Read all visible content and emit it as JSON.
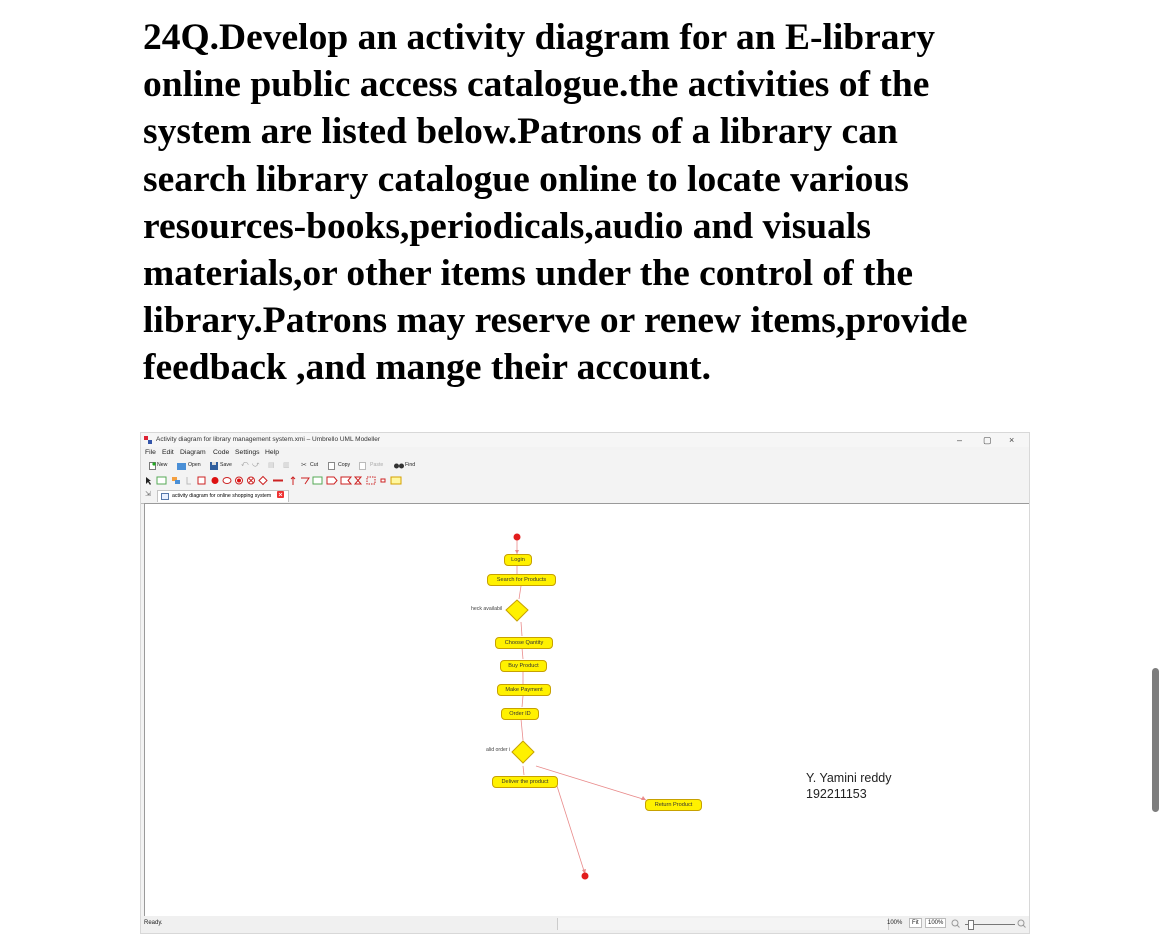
{
  "question": {
    "text": "24Q.Develop an activity diagram for an E-library\nonline public access catalogue.the activities of the\nsystem are listed below.Patrons of a library can\nsearch library catalogue online to locate various\nresources-books,periodicals,audio and visuals\nmaterials,or other items under the control of the\nlibrary.Patrons may reserve or renew items,provide\nfeedback ,and mange their account."
  },
  "window": {
    "title": "Activity diagram for library management system.xmi – Umbrello UML Modeller",
    "minimize": "–",
    "maximize": "▢",
    "close": "×"
  },
  "menu": [
    "File",
    "Edit",
    "Diagram",
    "Code",
    "Settings",
    "Help"
  ],
  "toolbar": {
    "new": "New",
    "open": "Open",
    "save": "Save",
    "cut": "Cut",
    "copy": "Copy",
    "paste": "Paste",
    "find": "Find"
  },
  "tab": {
    "label": "activity diagram for online shopping system"
  },
  "diagram": {
    "nodes": {
      "login": "Login",
      "search": "Search for Products",
      "choose": "Choose Qantity",
      "buy": "Buy Product",
      "payment": "Make Payment",
      "order_id": "Order ID",
      "deliver": "Deliver the product",
      "return": "Return Product"
    },
    "decisions": {
      "check": "heck availabil",
      "valid": "alid order i"
    }
  },
  "signature": {
    "name": "Y. Yamini reddy",
    "id": "192211153"
  },
  "status": {
    "ready": "Ready.",
    "zoom": "100%",
    "fit": "Fit",
    "zoom_box": "100%"
  },
  "colors": {
    "node_fill": "#fff100",
    "node_border": "#c7a100",
    "flow": "#e23b3b",
    "background": "#ffffff"
  },
  "icons": [
    "app-icon",
    "new-icon",
    "open-icon",
    "save-icon",
    "cut-icon",
    "copy-icon",
    "paste-icon",
    "find-icon",
    "zoom-out-icon",
    "zoom-in-icon"
  ]
}
